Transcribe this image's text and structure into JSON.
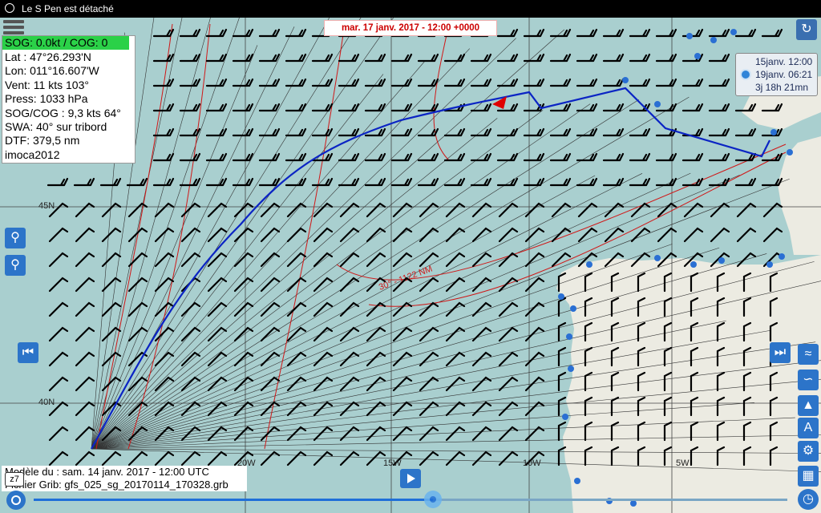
{
  "status_bar": {
    "text": "Le S Pen est détaché"
  },
  "info_panel": {
    "sog_header": "SOG: 0.0kt / COG: 0",
    "lat": "Lat :  47°26.293'N",
    "lon": "Lon: 011°16.607'W",
    "wind": "Vent:  11 kts 103°",
    "press": "Press: 1033 hPa",
    "sogcog": "SOG/COG : 9,3 kts 64°",
    "swa": "SWA: 40° sur tribord",
    "dtf": "DTF: 379,5 nm",
    "boat": "imoca2012"
  },
  "date_banner": "mar. 17 janv. 2017 - 12:00 +0000",
  "time_panel": {
    "start": "15janv. 12:00",
    "eta": "19janv. 06:21",
    "duration": "3j 18h 21mn"
  },
  "map": {
    "lat_labels": [
      "45N",
      "40N"
    ],
    "lon_labels": [
      "20W",
      "15W",
      "10W",
      "5W"
    ],
    "isochrone_label": "30° - 1122 NM",
    "colors": {
      "sea": "#a9cfcf",
      "land": "#ecebe2",
      "route": "#0b24c4",
      "isochrone": "#d01818",
      "boat": "#e00000"
    }
  },
  "bottom": {
    "model": "Modèle du : sam. 14 janv. 2017 - 12:00 UTC",
    "grib": "Fichier Grib: gfs_025_sg_20170114_170328.grb",
    "zoom": "z7"
  },
  "timeline": {
    "progress_fraction": 0.53
  },
  "icons": [
    "search-zoom-in-icon",
    "search-zoom-out-icon",
    "skip-back-icon",
    "skip-forward-icon",
    "layers-icon",
    "route-icon",
    "compass-icon",
    "settings-icon",
    "grid-icon",
    "clock-icon",
    "play-icon",
    "target-icon",
    "menu-icon"
  ]
}
